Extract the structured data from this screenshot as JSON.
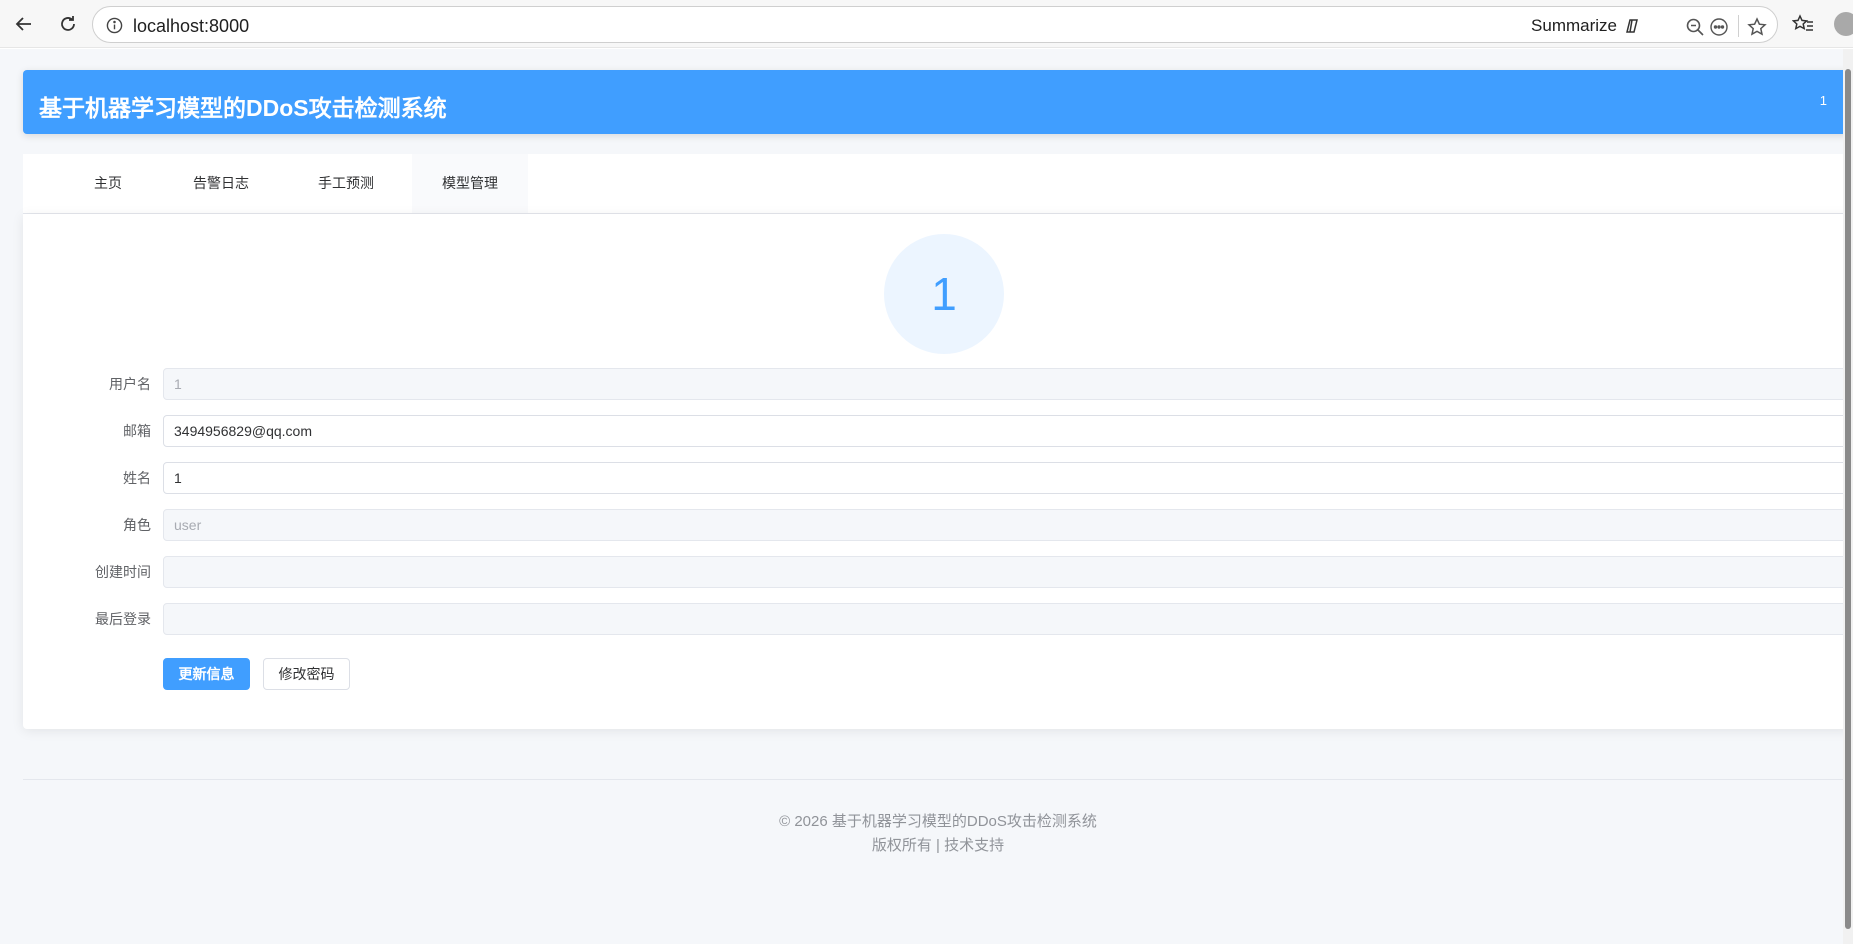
{
  "browser": {
    "url": "localhost:8000",
    "summarize_label": "Summarize"
  },
  "header": {
    "title": "基于机器学习模型的DDoS攻击检测系统",
    "username": "1"
  },
  "tabs": [
    {
      "label": "主页"
    },
    {
      "label": "告警日志"
    },
    {
      "label": "手工预测"
    },
    {
      "label": "模型管理"
    }
  ],
  "profile": {
    "avatar_text": "1",
    "fields": [
      {
        "label": "用户名",
        "value": "1",
        "disabled": true
      },
      {
        "label": "邮箱",
        "value": "3494956829@qq.com",
        "disabled": false
      },
      {
        "label": "姓名",
        "value": "1",
        "disabled": false
      },
      {
        "label": "角色",
        "value": "user",
        "disabled": true
      },
      {
        "label": "创建时间",
        "value": "",
        "disabled": true
      },
      {
        "label": "最后登录",
        "value": "",
        "disabled": true
      }
    ],
    "update_button": "更新信息",
    "password_button": "修改密码"
  },
  "footer": {
    "line1": "© 2026 基于机器学习模型的DDoS攻击检测系统",
    "line2": "版权所有 | 技术支持"
  },
  "colors": {
    "primary": "#409eff",
    "page_bg": "#f5f7fa",
    "avatar_bg": "#ecf5ff"
  }
}
